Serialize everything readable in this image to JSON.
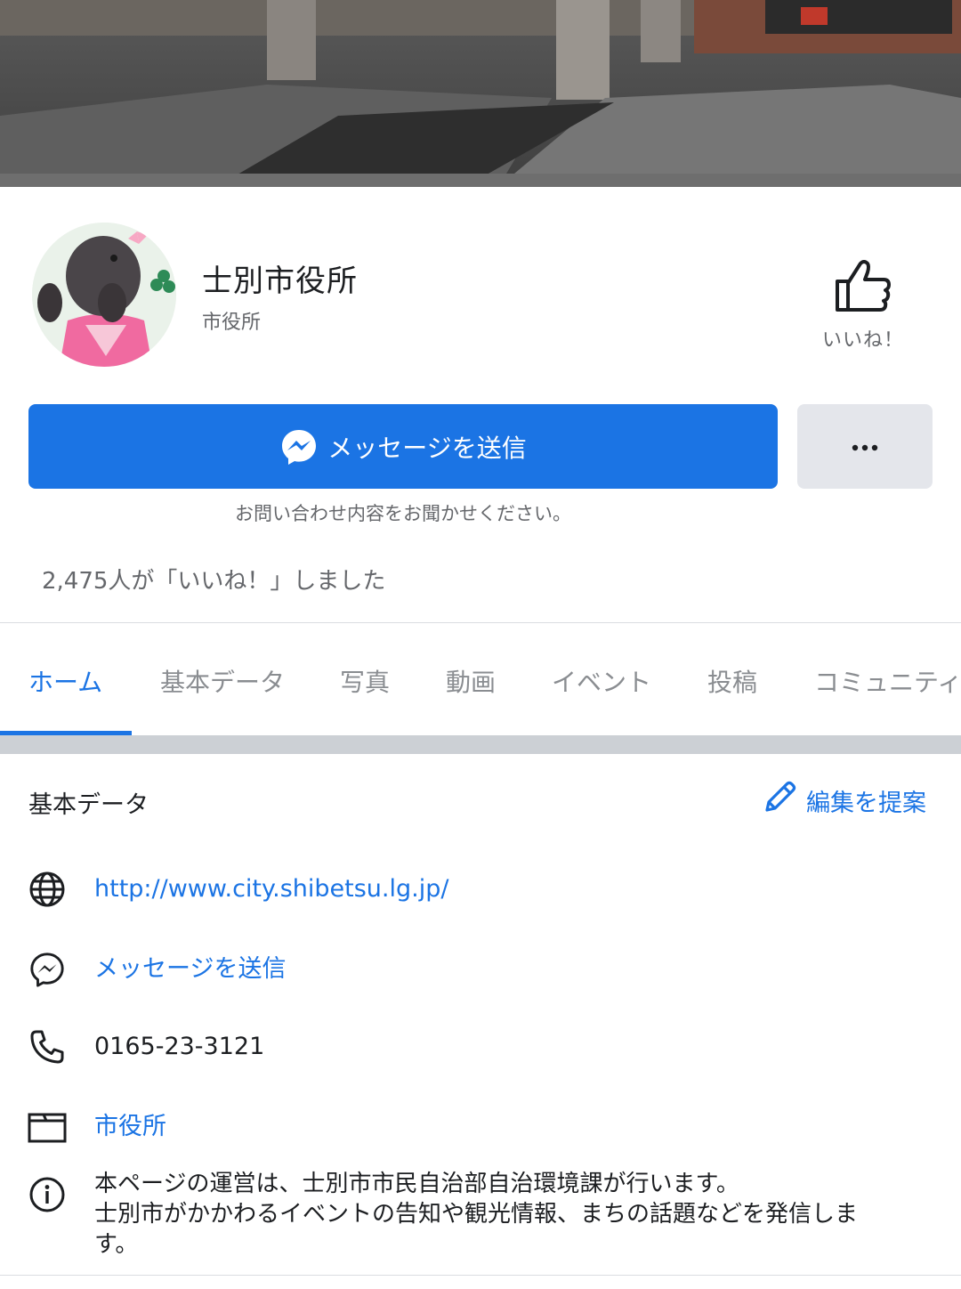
{
  "page": {
    "name": "士別市役所",
    "category": "市役所",
    "like_label": "いいね！",
    "message_button_label": "メッセージを送信",
    "message_hint": "お問い合わせ内容をお聞かせください。",
    "likes_summary": "2,475人が「いいね！」しました"
  },
  "tabs": [
    {
      "label": "ホーム",
      "active": true
    },
    {
      "label": "基本データ",
      "active": false
    },
    {
      "label": "写真",
      "active": false
    },
    {
      "label": "動画",
      "active": false
    },
    {
      "label": "イベント",
      "active": false
    },
    {
      "label": "投稿",
      "active": false
    },
    {
      "label": "コミュニティ",
      "active": false
    }
  ],
  "about": {
    "title": "基本データ",
    "suggest_edit_label": "編集を提案",
    "website": "http://www.city.shibetsu.lg.jp/",
    "messenger_label": "メッセージを送信",
    "phone": "0165-23-3121",
    "category_link": "市役所",
    "description_line1": "本ページの運営は、士別市市民自治部自治環境課が行います。",
    "description_line2": "士別市がかかわるイベントの告知や観光情報、まちの話題などを発信しま",
    "description_line3": "す。"
  },
  "icons": {
    "like": "thumbs-up-icon",
    "messenger": "messenger-icon",
    "more": "more-dots-icon",
    "edit": "pencil-icon",
    "website": "globe-icon",
    "phone": "phone-icon",
    "category": "folder-icon",
    "info": "info-icon"
  },
  "colors": {
    "accent": "#1b74e4",
    "secondary_text": "#65676b",
    "button_gray": "#e4e6eb"
  }
}
